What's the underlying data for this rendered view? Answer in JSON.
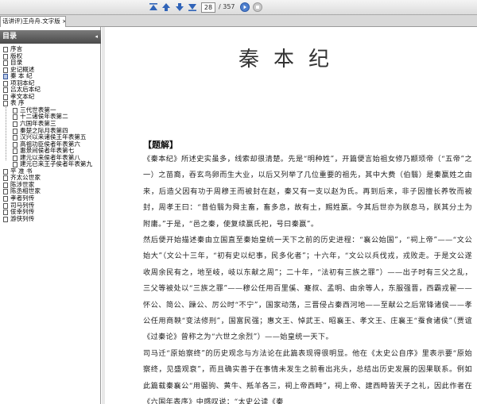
{
  "toolbar": {
    "current_page": "28",
    "total_pages": "/ 357",
    "buttons": [
      "first-page-icon",
      "prev-page-icon",
      "next-page-icon",
      "last-page-icon",
      "go-icon",
      "stop-icon"
    ]
  },
  "tab": {
    "label": "话讲评)王舟舟.文字版",
    "close": "×"
  },
  "sidebar": {
    "title": "目录",
    "collapse": "◂",
    "items": [
      {
        "label": "序言",
        "level": 0
      },
      {
        "label": "版权",
        "level": 0
      },
      {
        "label": "目录",
        "level": 0
      },
      {
        "label": "史记概述",
        "level": 0
      },
      {
        "label": "秦  本  纪",
        "level": 0,
        "open": true
      },
      {
        "label": "项羽本纪",
        "level": 0
      },
      {
        "label": "吕太后本纪",
        "level": 0
      },
      {
        "label": "孝文本纪",
        "level": 0
      },
      {
        "label": "表         序",
        "level": 0
      },
      {
        "label": "三代世表第一",
        "level": 1
      },
      {
        "label": "十二诸侯年表第二",
        "level": 1
      },
      {
        "label": "六国年表第三",
        "level": 1
      },
      {
        "label": "秦楚之际月表第四",
        "level": 1
      },
      {
        "label": "汉兴以来诸侯王年表第五",
        "level": 1
      },
      {
        "label": "高祖功臣侯者年表第六",
        "level": 1
      },
      {
        "label": "惠景间侯者年表第七",
        "level": 1
      },
      {
        "label": "建元以来侯者年表第八",
        "level": 1
      },
      {
        "label": "建元已来王子侯者年表第九",
        "level": 1
      },
      {
        "label": "平  准  书",
        "level": 0
      },
      {
        "label": "齐太公世家",
        "level": 0
      },
      {
        "label": "陈涉世家",
        "level": 0
      },
      {
        "label": "陈丞相世家",
        "level": 0
      },
      {
        "label": "孝者列传",
        "level": 0
      },
      {
        "label": "司马列传",
        "level": 0
      },
      {
        "label": "佞幸列传",
        "level": 0
      },
      {
        "label": "游侠列传",
        "level": 0
      }
    ]
  },
  "document": {
    "title": "秦本纪",
    "section": "【题解】",
    "paragraphs": [
      "《秦本纪》所述史实虽多，线索却很清楚。先是“明种姓”，开篇便言始祖女修乃颛顼帝（“五帝”之一）之苗裔，吞玄鸟卵而生大业，以后又列举了几位重要的祖先，其中大费（伯翳）是秦嬴姓之由来，后造父因有功于周穆王而被封在赵，秦又有一支以赵为氏。再到后来，非子因擅长养牧而被封，周孝王曰：“昔伯翳为舜主畜，畜多息，故有土，赐姓嬴。今其后世亦为朕息马，朕其分土为附庸。”于是，“邑之秦，使复续嬴氏祀，号曰秦嬴”。",
      "然后便开始描述秦由立国直至秦始皇统一天下之前的历史进程：“襄公始国”，“祠上帝”——“文公始大”（文公十三年，“初有史以纪事，民多化者”；十六年，“文公以兵伐戎，戎败走。于是文公遂收周余民有之，地至岐，岐以东献之周”；二十年，“法初有三族之罪”）——出子时有三父之乱，三父等被处以“三族之罪”——穆公任用百里傒、蹇叔、孟明、由余等人，东服强晋，西霸戎翟——怀公、简公、躁公、厉公时“不宁”，国家动荡，三晋侵占秦西河地——至献公之后常锋诸侯——孝公任用商鞅“变法修刑”，国富民强；惠文王、悼武王、昭襄王、孝文王、庄襄王“蚕食诸侯”（贾谊《过秦论》曾称之为“六世之余烈”）——始皇统一天下。",
      "司马迁“原始察终”的历史观念与方法论在此篇表现得很明显。他在《太史公自序》里表示要“原始察终，见盛观衰”，而且确实善于在事情未发生之前看出兆头，总结出历史发展的因果联系。例如此篇载秦襄公“用骝驹、黄牛、羝羊各三，祠上帝西畤”，祠上帝、建西畤皆天子之礼，因此作者在《六国年表序》中感叹说：“太史公读《秦"
    ]
  }
}
